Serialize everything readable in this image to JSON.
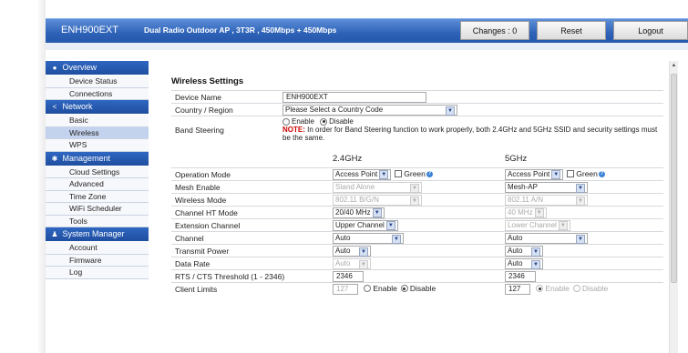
{
  "header": {
    "model": "ENH900EXT",
    "description": "Dual Radio Outdoor AP , 3T3R , 450Mbps + 450Mbps",
    "changes": "Changes : 0",
    "reset": "Reset",
    "logout": "Logout"
  },
  "sidebar": {
    "overview": "Overview",
    "device_status": "Device Status",
    "connections": "Connections",
    "network": "Network",
    "basic": "Basic",
    "wireless": "Wireless",
    "wps": "WPS",
    "management": "Management",
    "cloud_settings": "Cloud Settings",
    "advanced": "Advanced",
    "time_zone": "Time Zone",
    "wifi_scheduler": "WiFi Scheduler",
    "tools": "Tools",
    "system_manager": "System Manager",
    "account": "Account",
    "firmware": "Firmware",
    "log": "Log"
  },
  "main": {
    "title": "Wireless Settings",
    "device_name_label": "Device Name",
    "device_name_value": "ENH900EXT",
    "country_label": "Country / Region",
    "country_value": "Please Select a Country Code",
    "band_label": "Band Steering",
    "enable": "Enable",
    "disable": "Disable",
    "note_label": "NOTE:",
    "note_text": "In order for Band Steering function to work properly, both 2.4GHz and 5GHz SSID and security settings must be the same.",
    "col_24": "2.4GHz",
    "col_5": "5GHz",
    "rows": [
      {
        "label": "Operation Mode",
        "v24": "Access Point",
        "v5": "Access Point",
        "green": "Green"
      },
      {
        "label": "Mesh Enable",
        "v24": "Stand Alone",
        "v5": "Mesh-AP"
      },
      {
        "label": "Wireless Mode",
        "v24": "802.11 B/G/N",
        "v5": "802.11 A/N"
      },
      {
        "label": "Channel HT Mode",
        "v24": "20/40 MHz",
        "v5": "40 MHz"
      },
      {
        "label": "Extension Channel",
        "v24": "Upper Channel",
        "v5": "Lower Channel"
      },
      {
        "label": "Channel",
        "v24": "Auto",
        "v5": "Auto"
      },
      {
        "label": "Transmit Power",
        "v24": "Auto",
        "v5": "Auto"
      },
      {
        "label": "Data Rate",
        "v24": "Auto",
        "v5": "Auto"
      },
      {
        "label": "RTS / CTS Threshold (1 - 2346)",
        "v24": "2346",
        "v5": "2346"
      },
      {
        "label": "Client Limits",
        "v24": "127",
        "v5": "127"
      }
    ]
  }
}
